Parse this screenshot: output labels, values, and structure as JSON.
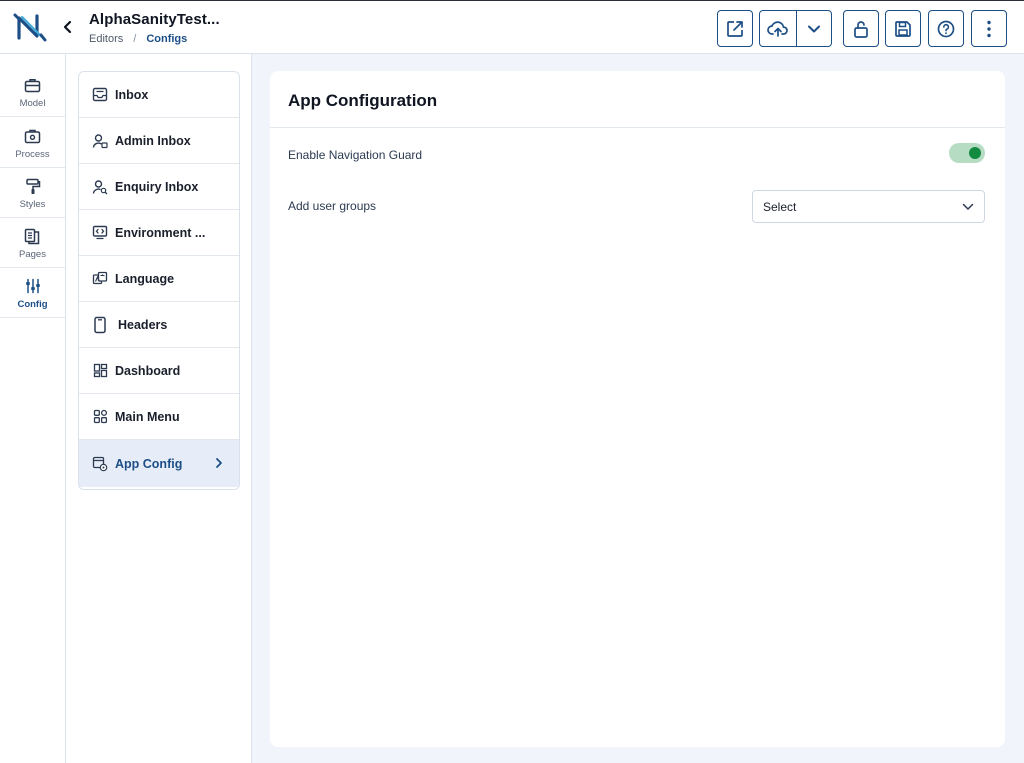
{
  "header": {
    "app_title": "AlphaSanityTest...",
    "breadcrumb": {
      "root": "Editors",
      "separator": "/",
      "current": "Configs"
    },
    "toolbar": {
      "open_icon": "external-link-icon",
      "publish_icon": "cloud-upload-icon",
      "publish_menu_icon": "chevron-down-icon",
      "lock_icon": "unlock-icon",
      "save_icon": "save-icon",
      "help_icon": "help-circle-icon",
      "more_icon": "more-vertical-icon"
    }
  },
  "rail": {
    "items": [
      {
        "label": "Model",
        "icon": "briefcase-icon",
        "active": false
      },
      {
        "label": "Process",
        "icon": "camera-box-icon",
        "active": false
      },
      {
        "label": "Styles",
        "icon": "paint-roller-icon",
        "active": false
      },
      {
        "label": "Pages",
        "icon": "pages-icon",
        "active": false
      },
      {
        "label": "Config",
        "icon": "sliders-icon",
        "active": true
      }
    ]
  },
  "config_list": {
    "items": [
      {
        "label": "Inbox",
        "icon": "inbox-icon"
      },
      {
        "label": "Admin Inbox",
        "icon": "admin-user-icon"
      },
      {
        "label": "Enquiry Inbox",
        "icon": "user-search-icon"
      },
      {
        "label": "Environment ...",
        "icon": "code-window-icon"
      },
      {
        "label": "Language",
        "icon": "translate-icon"
      },
      {
        "label": "Headers",
        "icon": "mobile-icon"
      },
      {
        "label": "Dashboard",
        "icon": "dashboard-icon"
      },
      {
        "label": "Main Menu",
        "icon": "grid-menu-icon"
      },
      {
        "label": "App Config",
        "icon": "app-settings-icon",
        "active": true
      }
    ]
  },
  "main": {
    "title": "App Configuration",
    "nav_guard_label": "Enable Navigation Guard",
    "nav_guard_enabled": true,
    "user_groups_label": "Add user groups",
    "user_groups_select": "Select"
  },
  "colors": {
    "primary": "#1d4f86",
    "toggle_on": "#128a3f",
    "toggle_track": "#b6dcc3",
    "background": "#f1f4fa"
  }
}
